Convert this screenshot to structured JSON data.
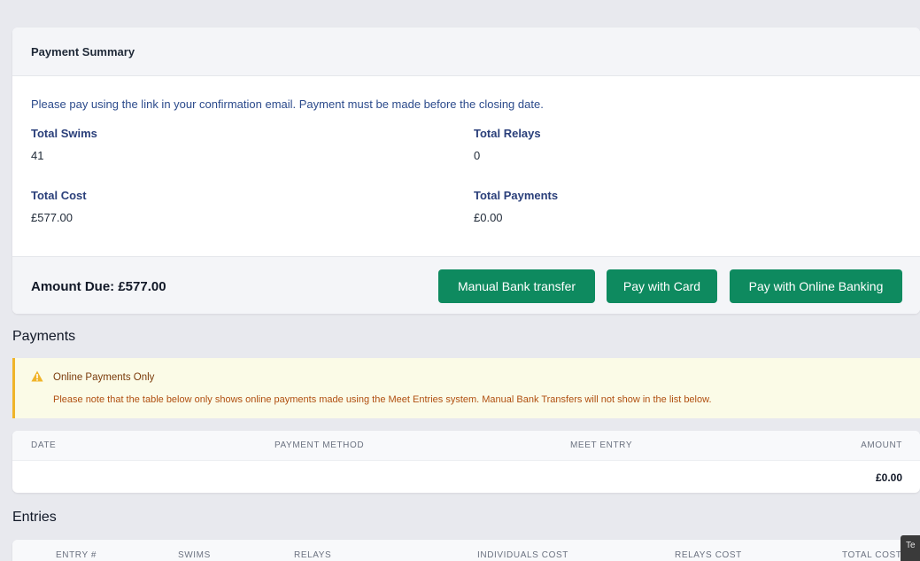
{
  "summary": {
    "title": "Payment Summary",
    "notice": "Please pay using the link in your confirmation email. Payment must be made before the closing date.",
    "total_swims_label": "Total Swims",
    "total_swims_value": "41",
    "total_relays_label": "Total Relays",
    "total_relays_value": "0",
    "total_cost_label": "Total Cost",
    "total_cost_value": "£577.00",
    "total_payments_label": "Total Payments",
    "total_payments_value": "£0.00",
    "amount_due": "Amount Due: £577.00",
    "buttons": {
      "bank_transfer": "Manual Bank transfer",
      "card": "Pay with Card",
      "online_banking": "Pay with Online Banking"
    }
  },
  "payments": {
    "heading": "Payments",
    "alert": {
      "title": "Online Payments Only",
      "text": "Please note that the table below only shows online payments made using the Meet Entries system. Manual Bank Transfers will not show in the list below."
    },
    "columns": [
      "DATE",
      "PAYMENT METHOD",
      "MEET ENTRY",
      "AMOUNT"
    ],
    "total_amount": "£0.00"
  },
  "entries": {
    "heading": "Entries",
    "columns": [
      "ENTRY #",
      "SWIMS",
      "RELAYS",
      "INDIVIDUALS COST",
      "RELAYS COST",
      "TOTAL COST"
    ]
  },
  "tooltip": "Te",
  "colors": {
    "button_green": "#0e8a5f",
    "link_blue": "#2b4a8b",
    "warning_border": "#f0b429",
    "warning_bg": "#fbfbe7"
  },
  "icons": {
    "alert": "warning-triangle-icon"
  }
}
